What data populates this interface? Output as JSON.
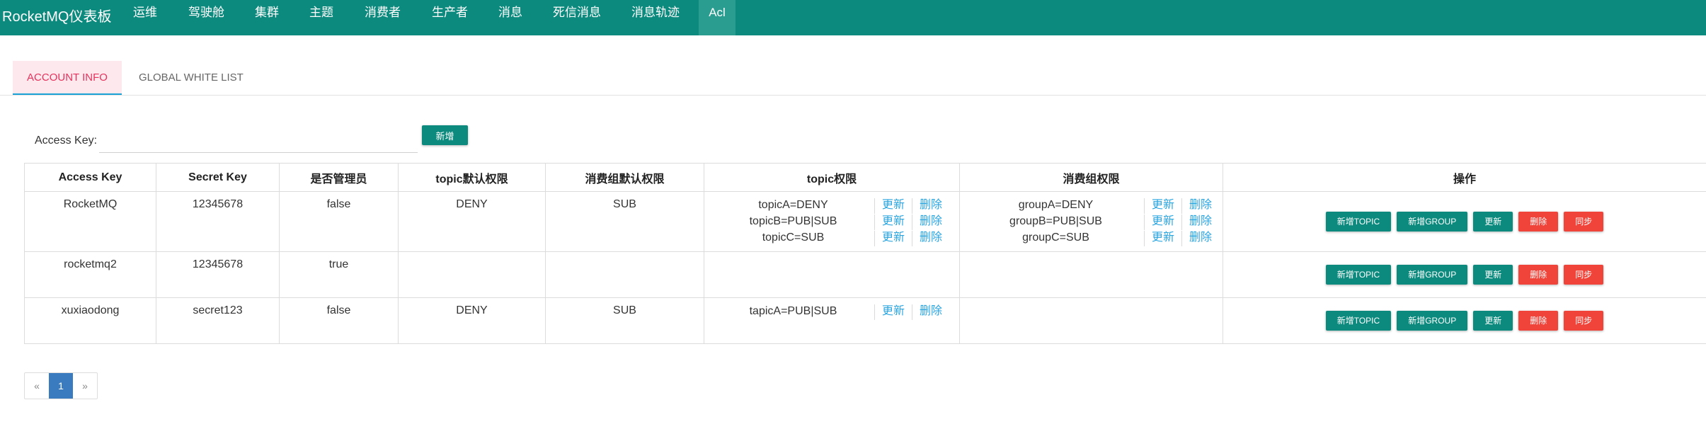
{
  "navbar": {
    "brand": "RocketMQ仪表板",
    "items": [
      "运维",
      "驾驶舱",
      "集群",
      "主题",
      "消费者",
      "生产者",
      "消息",
      "死信消息",
      "消息轨迹",
      "Acl"
    ],
    "active": "Acl"
  },
  "tabs": [
    {
      "label": "ACCOUNT INFO",
      "active": true
    },
    {
      "label": "GLOBAL WHITE LIST",
      "active": false
    }
  ],
  "access_key": {
    "label": "Access Key:",
    "value": "",
    "add_button": "新增"
  },
  "table": {
    "headers": [
      "Access Key",
      "Secret Key",
      "是否管理员",
      "topic默认权限",
      "消费组默认权限",
      "topic权限",
      "消费组权限",
      "操作"
    ],
    "rows": [
      {
        "access_key": "RocketMQ",
        "secret_key": "12345678",
        "admin": "false",
        "topic_default": "DENY",
        "group_default": "SUB",
        "topic_perms": [
          "topicA=DENY",
          "topicB=PUB|SUB",
          "topicC=SUB"
        ],
        "group_perms": [
          "groupA=DENY",
          "groupB=PUB|SUB",
          "groupC=SUB"
        ]
      },
      {
        "access_key": "rocketmq2",
        "secret_key": "12345678",
        "admin": "true",
        "topic_default": "",
        "group_default": "",
        "topic_perms": [],
        "group_perms": []
      },
      {
        "access_key": "xuxiaodong",
        "secret_key": "secret123",
        "admin": "false",
        "topic_default": "DENY",
        "group_default": "SUB",
        "topic_perms": [
          "tapicA=PUB|SUB"
        ],
        "group_perms": []
      }
    ],
    "perm_links": {
      "update": "更新",
      "delete": "删除"
    },
    "ops": {
      "add_topic": "新增TOPIC",
      "add_group": "新增GROUP",
      "update": "更新",
      "delete": "删除",
      "sync": "同步"
    }
  },
  "pagination": {
    "prev": "«",
    "current": "1",
    "next": "»"
  },
  "colors": {
    "navbar": "#0d8a7e",
    "teal_button": "#0d8a7e",
    "red_button": "#f0443a",
    "link": "#2aa5e0",
    "active_tab_text": "#e5335d",
    "active_tab_bg": "#fce8ed"
  }
}
